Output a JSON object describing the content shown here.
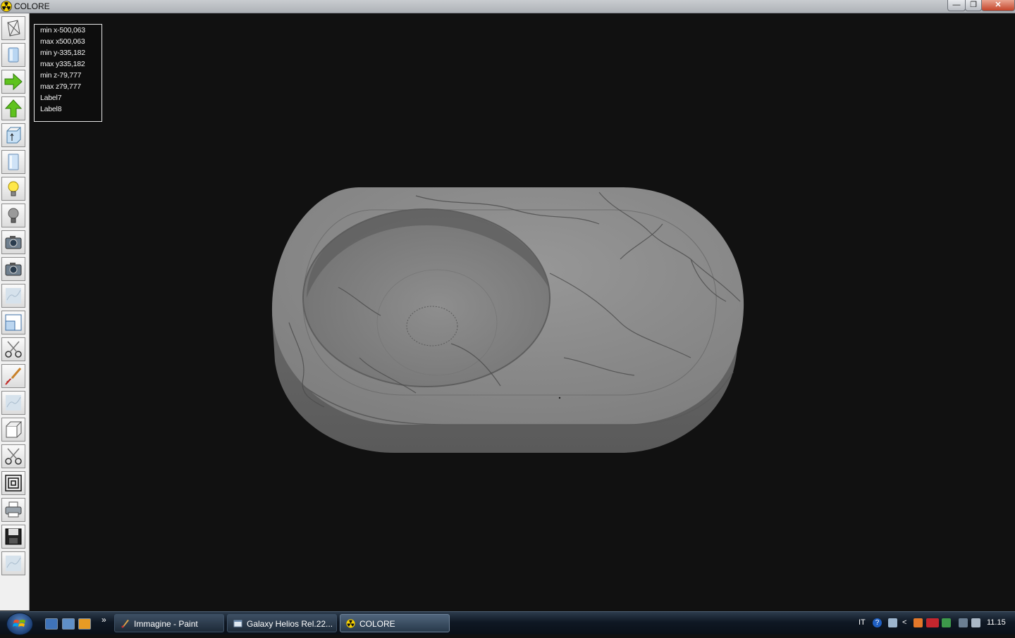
{
  "window": {
    "title": "COLORE",
    "controls": {
      "minimize": "—",
      "restore": "❐",
      "close": "✕"
    }
  },
  "toolbar": {
    "tools": [
      "wireframe-icon",
      "solid-view-icon",
      "arrow-right-icon",
      "arrow-up-icon",
      "extrude-icon",
      "panel-view-icon",
      "light-on-icon",
      "light-off-icon",
      "camera-icon",
      "camera-2-icon",
      "marble-texture-icon",
      "split-view-icon",
      "scissors-icon",
      "brush-icon",
      "marble-texture-2-icon",
      "box-icon",
      "scissors-2-icon",
      "nested-squares-icon",
      "printer-icon",
      "save-icon",
      "marble-texture-3-icon"
    ]
  },
  "bounds": {
    "min_x": "min x-500,063",
    "max_x": "max x500,063",
    "min_y": "min y-335,182",
    "max_y": "max y335,182",
    "min_z": "min z-79,777",
    "max_z": "max z79,777",
    "label7": "Label7",
    "label8": "Label8"
  },
  "taskbar": {
    "buttons": [
      {
        "label": "Immagine - Paint"
      },
      {
        "label": "Galaxy Helios  Rel.22..."
      },
      {
        "label": "COLORE"
      }
    ],
    "chevron": "»",
    "tray": {
      "language": "IT",
      "clock": "11.15",
      "expand": "<",
      "help": "?"
    }
  },
  "colors": {
    "viewport_bg": "#111111",
    "marble_base": "#8a8a8a",
    "marble_veins": "#3a3a3a"
  }
}
